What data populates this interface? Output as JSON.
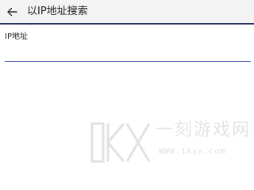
{
  "appbar": {
    "back_icon": "arrow-left-icon",
    "title": "以IP地址搜索"
  },
  "search_field": {
    "label": "IP地址",
    "value": "",
    "placeholder": ""
  },
  "watermark": {
    "logo_text": "1KX",
    "site_name": "一刻游戏网",
    "url": "WWW.1kyx.com"
  },
  "colors": {
    "accent": "#3f51b5",
    "appbar_bg": "#f3f3f3",
    "appbar_border": "#2a3563",
    "watermark": "#e4e4e4"
  }
}
